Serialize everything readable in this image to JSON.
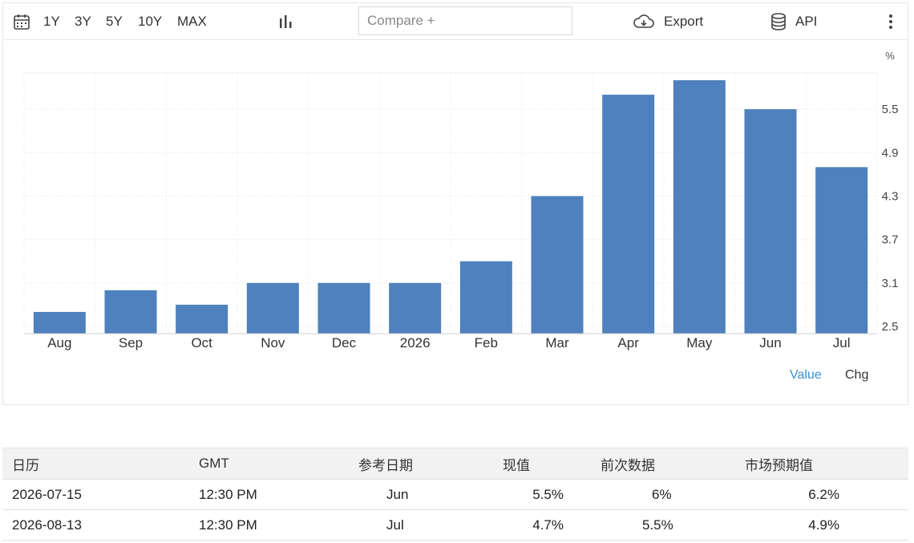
{
  "toolbar": {
    "ranges": [
      "1Y",
      "3Y",
      "5Y",
      "10Y",
      "MAX"
    ],
    "compare_placeholder": "Compare +",
    "export_label": "Export",
    "api_label": "API",
    "icons": [
      "calendar-icon",
      "bar-chart-icon",
      "cloud-download-icon",
      "database-icon",
      "more-vertical-icon"
    ]
  },
  "chart_data": {
    "type": "bar",
    "categories": [
      "Aug",
      "Sep",
      "Oct",
      "Nov",
      "Dec",
      "2026",
      "Feb",
      "Mar",
      "Apr",
      "May",
      "Jun",
      "Jul"
    ],
    "values": [
      2.7,
      3.0,
      2.8,
      3.1,
      3.1,
      3.1,
      3.4,
      4.3,
      5.7,
      5.9,
      5.5,
      4.7
    ],
    "unit_label": "%",
    "y_ticks": [
      "2.5",
      "3.1",
      "3.7",
      "4.3",
      "4.9",
      "5.5"
    ],
    "ylim": [
      2.4,
      6.0
    ],
    "grid": true,
    "bar_color": "#4e81bd",
    "axis_position": "right"
  },
  "toggles": {
    "value_label": "Value",
    "chg_label": "Chg",
    "active_color": "#3a8fd6"
  },
  "calendar": {
    "headers": [
      "日历",
      "GMT",
      "参考日期",
      "现值",
      "前次数据",
      "市场预期值"
    ],
    "rows": [
      [
        "2026-07-15",
        "12:30 PM",
        "Jun",
        "5.5%",
        "6%",
        "6.2%"
      ],
      [
        "2026-08-13",
        "12:30 PM",
        "Jul",
        "4.7%",
        "5.5%",
        "4.9%"
      ]
    ]
  }
}
